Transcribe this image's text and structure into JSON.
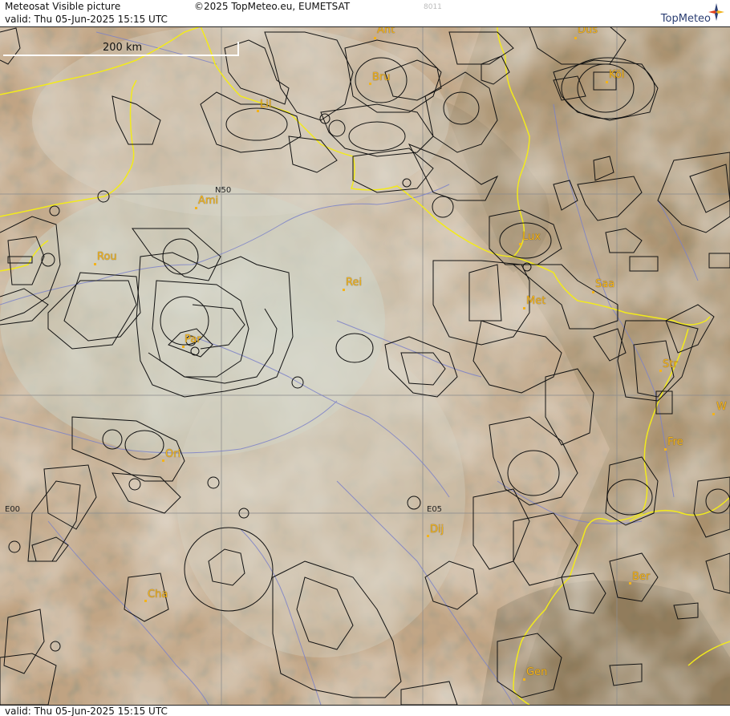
{
  "header": {
    "title": "Meteosat Visible picture",
    "valid": "valid:  Thu  05-Jun-2025  15:15 UTC",
    "copyright": "©2025 TopMeteo.eu, EUMETSAT",
    "code": "8011",
    "logo": "TopMeteo"
  },
  "footer": {
    "valid": "valid:  Thu  05-Jun-2025  15:15 UTC"
  },
  "scale": {
    "label": "200 km"
  },
  "grid_labels": {
    "n50": "N50",
    "e00": "E00",
    "e05": "E05"
  },
  "cities": [
    {
      "name": "Ant"
    },
    {
      "name": "Düs"
    },
    {
      "name": "Bru"
    },
    {
      "name": "Köl"
    },
    {
      "name": "Lil"
    },
    {
      "name": "Ami"
    },
    {
      "name": "Rou"
    },
    {
      "name": "Lux"
    },
    {
      "name": "Rei"
    },
    {
      "name": "Saa"
    },
    {
      "name": "Met"
    },
    {
      "name": "Par"
    },
    {
      "name": "Str"
    },
    {
      "name": "W"
    },
    {
      "name": "Fre"
    },
    {
      "name": "Orl"
    },
    {
      "name": "Dij"
    },
    {
      "name": "Ber"
    },
    {
      "name": "Cha"
    },
    {
      "name": "Gen"
    }
  ],
  "colors": {
    "border": "#f2ea1c",
    "city_label": "#f3b31a",
    "airspace": "#111111",
    "rivers": "#7d82c8",
    "grid": "#8d8d8d"
  }
}
